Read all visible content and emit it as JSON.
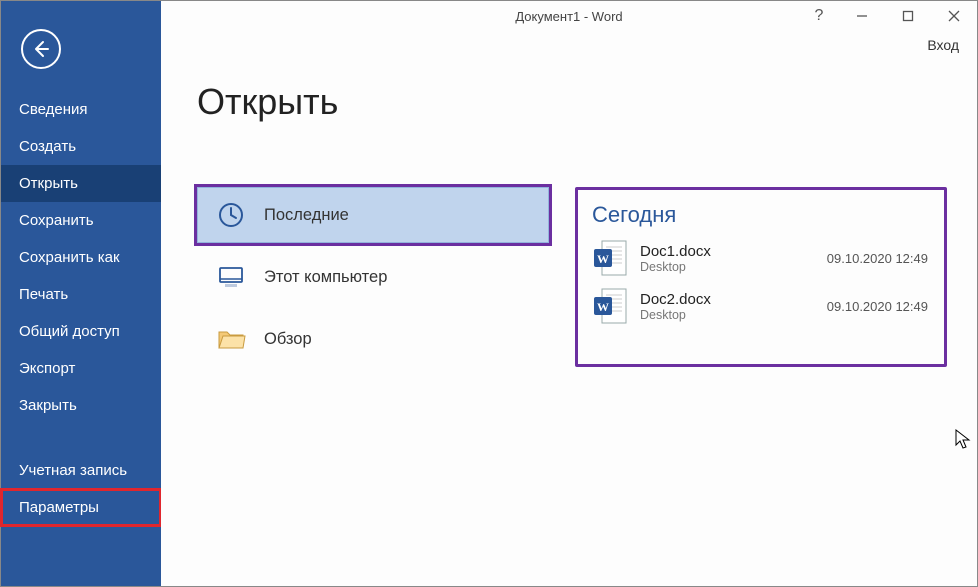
{
  "titlebar": {
    "title": "Документ1 - Word"
  },
  "signin_label": "Вход",
  "sidebar": {
    "items": [
      {
        "label": "Сведения"
      },
      {
        "label": "Создать"
      },
      {
        "label": "Открыть"
      },
      {
        "label": "Сохранить"
      },
      {
        "label": "Сохранить как"
      },
      {
        "label": "Печать"
      },
      {
        "label": "Общий доступ"
      },
      {
        "label": "Экспорт"
      },
      {
        "label": "Закрыть"
      }
    ],
    "footer": [
      {
        "label": "Учетная запись"
      },
      {
        "label": "Параметры"
      }
    ]
  },
  "main": {
    "heading": "Открыть",
    "places": [
      {
        "label": "Последние"
      },
      {
        "label": "Этот компьютер"
      },
      {
        "label": "Обзор"
      }
    ],
    "group_title": "Сегодня",
    "files": [
      {
        "name": "Doc1.docx",
        "location": "Desktop",
        "date": "09.10.2020 12:49"
      },
      {
        "name": "Doc2.docx",
        "location": "Desktop",
        "date": "09.10.2020 12:49"
      }
    ]
  }
}
